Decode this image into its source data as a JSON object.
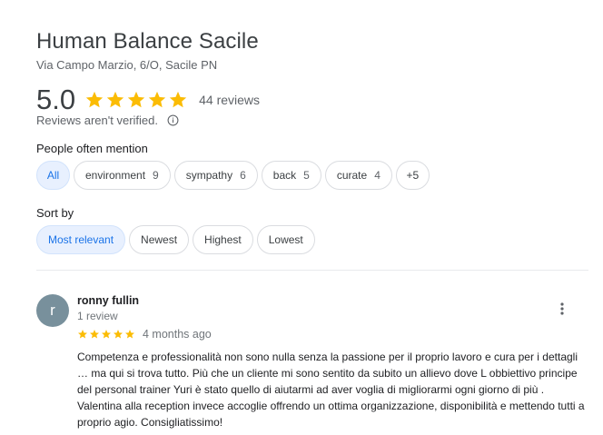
{
  "place": {
    "title": "Human Balance Sacile",
    "address": "Via Campo Marzio, 6/O, Sacile PN"
  },
  "summary": {
    "rating": "5.0",
    "stars": 5,
    "reviews_label": "44 reviews",
    "verified_text": "Reviews aren't verified.",
    "star_color": "#fbbc04"
  },
  "mentions": {
    "label": "People often mention",
    "chips": [
      {
        "label": "All",
        "count": ""
      },
      {
        "label": "environment",
        "count": "9"
      },
      {
        "label": "sympathy",
        "count": "6"
      },
      {
        "label": "back",
        "count": "5"
      },
      {
        "label": "curate",
        "count": "4"
      },
      {
        "label": "+5",
        "count": ""
      }
    ]
  },
  "sort": {
    "label": "Sort by",
    "options": [
      "Most relevant",
      "Newest",
      "Highest",
      "Lowest"
    ],
    "selected": "Most relevant"
  },
  "review": {
    "avatar_letter": "r",
    "avatar_color": "#78909c",
    "name": "ronny fullin",
    "meta": "1 review",
    "stars": 5,
    "date": "4 months ago",
    "text": "Competenza e professionalità non sono nulla senza la passione per il proprio lavoro e cura per i dettagli … ma qui si trova tutto.  Più che un cliente mi sono sentito da subito un allievo dove L obbiettivo principe del personal trainer Yuri è stato quello di aiutarmi ad aver voglia di migliorarmi ogni giorno di più . Valentina alla reception invece accoglie offrendo un ottima organizzazione, disponibilità e mettendo tutti a proprio agio. Consigliatissimo!"
  },
  "icons": {
    "info": "info-circle-icon",
    "more": "more-vert-icon",
    "star": "star-icon"
  },
  "colors": {
    "accent": "#1a73e8",
    "chip_active_bg": "#e8f0fe"
  }
}
